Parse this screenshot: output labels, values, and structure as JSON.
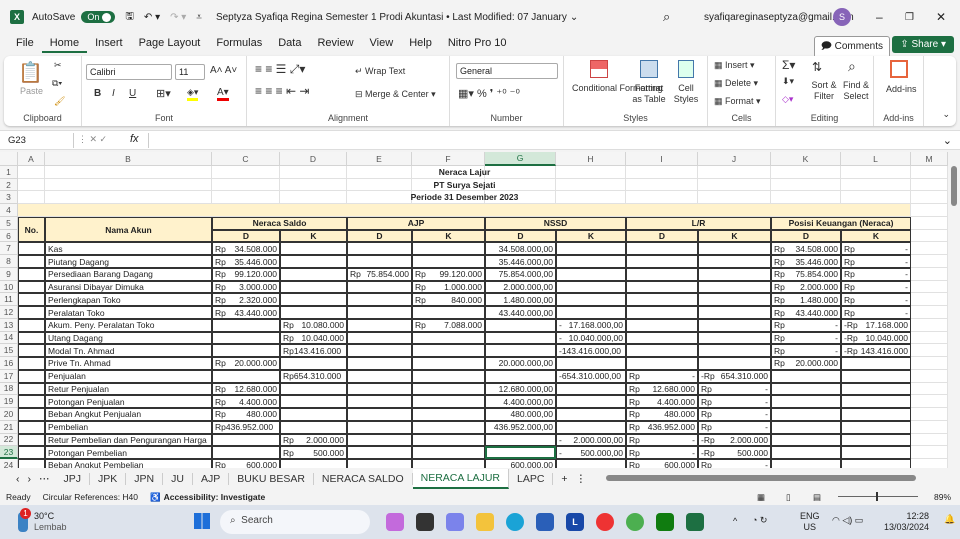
{
  "titlebar": {
    "autosave": "AutoSave",
    "toggle": "On",
    "doc_title": "Septyza Syafiqa Regina Semester 1 Prodi Akuntasi • Last Modified: 07 January",
    "email": "syafiqareginaseptyza@gmail.com",
    "avatar": "S"
  },
  "menu": [
    "File",
    "Home",
    "Insert",
    "Page Layout",
    "Formulas",
    "Data",
    "Review",
    "View",
    "Help",
    "Nitro Pro 10"
  ],
  "menu_buttons": {
    "comments": "Comments",
    "share": "Share"
  },
  "ribbon": {
    "clipboard": {
      "label": "Clipboard",
      "paste": "Paste"
    },
    "font": {
      "label": "Font",
      "name": "Calibri",
      "size": "11",
      "bold": "B",
      "italic": "I",
      "underline": "U"
    },
    "alignment": {
      "label": "Alignment",
      "wrap": "Wrap Text",
      "merge": "Merge & Center"
    },
    "number": {
      "label": "Number",
      "format": "General"
    },
    "styles": {
      "label": "Styles",
      "conditional": "Conditional Formatting",
      "format_table": "Format as Table",
      "cell_styles": "Cell Styles"
    },
    "cells": {
      "label": "Cells",
      "insert": "Insert",
      "delete": "Delete",
      "format": "Format"
    },
    "editing": {
      "label": "Editing",
      "sort": "Sort & Filter",
      "find": "Find & Select"
    },
    "addins": {
      "label": "Add-ins",
      "btn": "Add-ins"
    }
  },
  "formula_bar": {
    "name_box": "G23",
    "fx": "fx",
    "value": ""
  },
  "columns": [
    "A",
    "B",
    "C",
    "D",
    "E",
    "F",
    "G",
    "H",
    "I",
    "J",
    "K",
    "L",
    "M"
  ],
  "selected": {
    "col": "G",
    "row": 23
  },
  "sheet": {
    "title1": "Neraca Lajur",
    "title2": "PT Surya Sejati",
    "title3": "Periode 31 Desember 2023",
    "h_no": "No.",
    "h_nama": "Nama Akun",
    "groups": [
      "Neraca Saldo",
      "AJP",
      "NSSD",
      "L/R",
      "Posisi Keuangan (Neraca)"
    ],
    "dk": [
      "D",
      "K"
    ],
    "rows": [
      [
        "Kas",
        "Rp 34.508.000",
        "",
        "",
        "",
        "34.508.000,00",
        "",
        "",
        "",
        "Rp 34.508.000",
        "Rp -"
      ],
      [
        "Piutang Dagang",
        "Rp 35.446.000",
        "",
        "",
        "",
        "35.446.000,00",
        "",
        "",
        "",
        "Rp 35.446.000",
        "Rp -"
      ],
      [
        "Persediaan Barang Dagang",
        "Rp 99.120.000",
        "",
        "Rp 75.854.000",
        "Rp 99.120.000",
        "75.854.000,00",
        "",
        "",
        "",
        "Rp 75.854.000",
        "Rp -"
      ],
      [
        "Asuransi Dibayar Dimuka",
        "Rp 3.000.000",
        "",
        "",
        "Rp 1.000.000",
        "2.000.000,00",
        "",
        "",
        "",
        "Rp 2.000.000",
        "Rp -"
      ],
      [
        "Perlengkapan Toko",
        "Rp 2.320.000",
        "",
        "",
        "Rp 840.000",
        "1.480.000,00",
        "",
        "",
        "",
        "Rp 1.480.000",
        "Rp -"
      ],
      [
        "Peralatan Toko",
        "Rp 43.440.000",
        "",
        "",
        "",
        "43.440.000,00",
        "",
        "",
        "",
        "Rp 43.440.000",
        "Rp -"
      ],
      [
        "Akum. Peny. Peralatan Toko",
        "",
        "Rp 10.080.000",
        "",
        "Rp 7.088.000",
        "",
        "- 17.168.000,00",
        "",
        "",
        "Rp -",
        "-Rp 17.168.000"
      ],
      [
        "Utang Dagang",
        "",
        "Rp 10.040.000",
        "",
        "",
        "",
        "- 10.040.000,00",
        "",
        "",
        "Rp -",
        "-Rp 10.040.000"
      ],
      [
        "Modal Tn. Ahmad",
        "",
        "Rp143.416.000",
        "",
        "",
        "",
        "-143.416.000,00",
        "",
        "",
        "Rp -",
        "-Rp 143.416.000"
      ],
      [
        "Prive Tn. Ahmad",
        "Rp 20.000.000",
        "",
        "",
        "",
        "20.000.000,00",
        "",
        "",
        "",
        "Rp 20.000.000",
        ""
      ],
      [
        "Penjualan",
        "",
        "Rp654.310.000",
        "",
        "",
        "",
        "-654.310.000,00",
        "Rp -",
        "-Rp 654.310.000",
        "",
        ""
      ],
      [
        "Retur Penjualan",
        "Rp 12.680.000",
        "",
        "",
        "",
        "12.680.000,00",
        "",
        "Rp 12.680.000",
        "Rp -",
        "",
        ""
      ],
      [
        "Potongan Penjualan",
        "Rp 4.400.000",
        "",
        "",
        "",
        "4.400.000,00",
        "",
        "Rp 4.400.000",
        "Rp -",
        "",
        ""
      ],
      [
        "Beban Angkut Penjualan",
        "Rp 480.000",
        "",
        "",
        "",
        "480.000,00",
        "",
        "Rp 480.000",
        "Rp -",
        "",
        ""
      ],
      [
        "Pembelian",
        "Rp436.952.000",
        "",
        "",
        "",
        "436.952.000,00",
        "",
        "Rp 436.952.000",
        "Rp -",
        "",
        ""
      ],
      [
        "Retur Pembelian dan Pengurangan Harga",
        "",
        "Rp 2.000.000",
        "",
        "",
        "",
        "- 2.000.000,00",
        "Rp -",
        "-Rp 2.000.000",
        "",
        ""
      ],
      [
        "Potongan Pembelian",
        "",
        "Rp 500.000",
        "",
        "",
        "",
        "- 500.000,00",
        "Rp -",
        "-Rp 500.000",
        "",
        ""
      ],
      [
        "Beban Angkut Pembelian",
        "Rp 600.000",
        "",
        "",
        "",
        "600.000,00",
        "",
        "Rp 600.000",
        "Rp -",
        "",
        ""
      ]
    ]
  },
  "tabs": [
    "JPJ",
    "JPK",
    "JPN",
    "JU",
    "AJP",
    "BUKU BESAR",
    "NERACA SALDO",
    "NERACA LAJUR",
    "LAPC"
  ],
  "active_tab": "NERACA LAJUR",
  "status": {
    "ready": "Ready",
    "circular": "Circular References: H40",
    "accessibility": "Accessibility: Investigate",
    "zoom": "89%"
  },
  "taskbar": {
    "temp": "30°C",
    "weather": "Lembab",
    "badge": "1",
    "search": "Search",
    "lang1": "ENG",
    "lang2": "US",
    "time": "12:28",
    "date": "13/03/2024"
  }
}
